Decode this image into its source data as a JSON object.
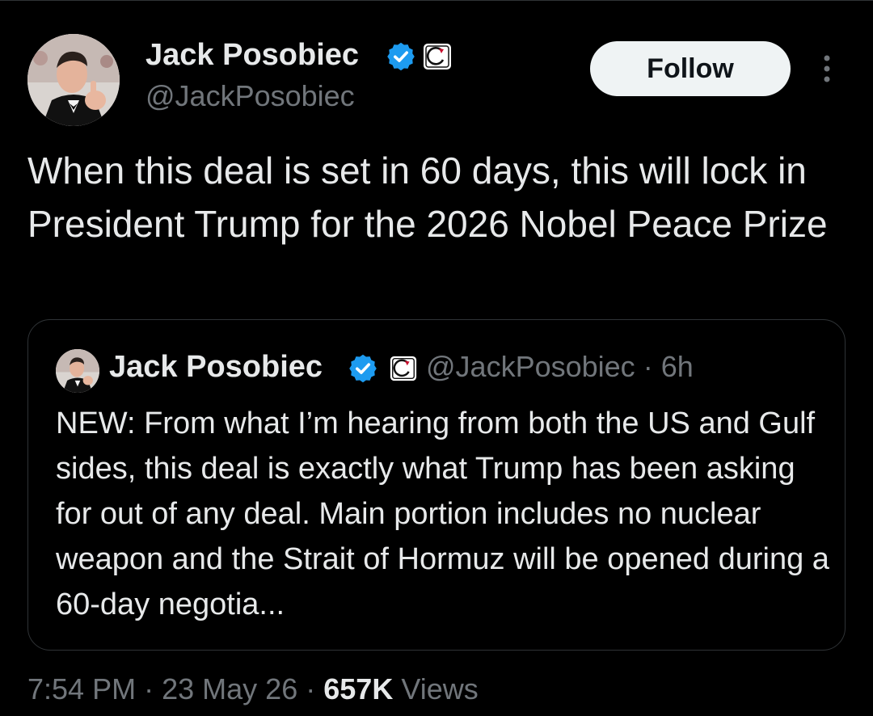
{
  "author": {
    "name": "Jack Posobiec",
    "handle": "@JackPosobiec"
  },
  "follow_button": {
    "label": "Follow"
  },
  "tweet": {
    "text": "When this deal is set in 60 days, this will lock in President Trump for the 2026 Nobel Peace Prize"
  },
  "quote": {
    "author_name": "Jack Posobiec",
    "handle": "@JackPosobiec",
    "separator": "·",
    "age": "6h",
    "text": "NEW: From what I’m hearing from both the US and Gulf sides, this deal is exactly what Trump has been asking for out of any deal. Main portion includes no nuclear weapon and the Strait of Hormuz will be opened during a 60-day negotia..."
  },
  "meta": {
    "time": "7:54 PM",
    "separator": "·",
    "date": "23 May 26",
    "views_count": "657K",
    "views_label": "Views"
  },
  "icons": {
    "verified": "verified-badge-icon",
    "affiliate": "affiliate-badge-icon",
    "more": "more-vertical-icon"
  },
  "colors": {
    "background": "#000000",
    "primary_text": "#e7e9ea",
    "secondary_text": "#71767b",
    "verified_blue": "#1d9bf0",
    "border": "#2f3336",
    "button_bg": "#eff3f4"
  }
}
